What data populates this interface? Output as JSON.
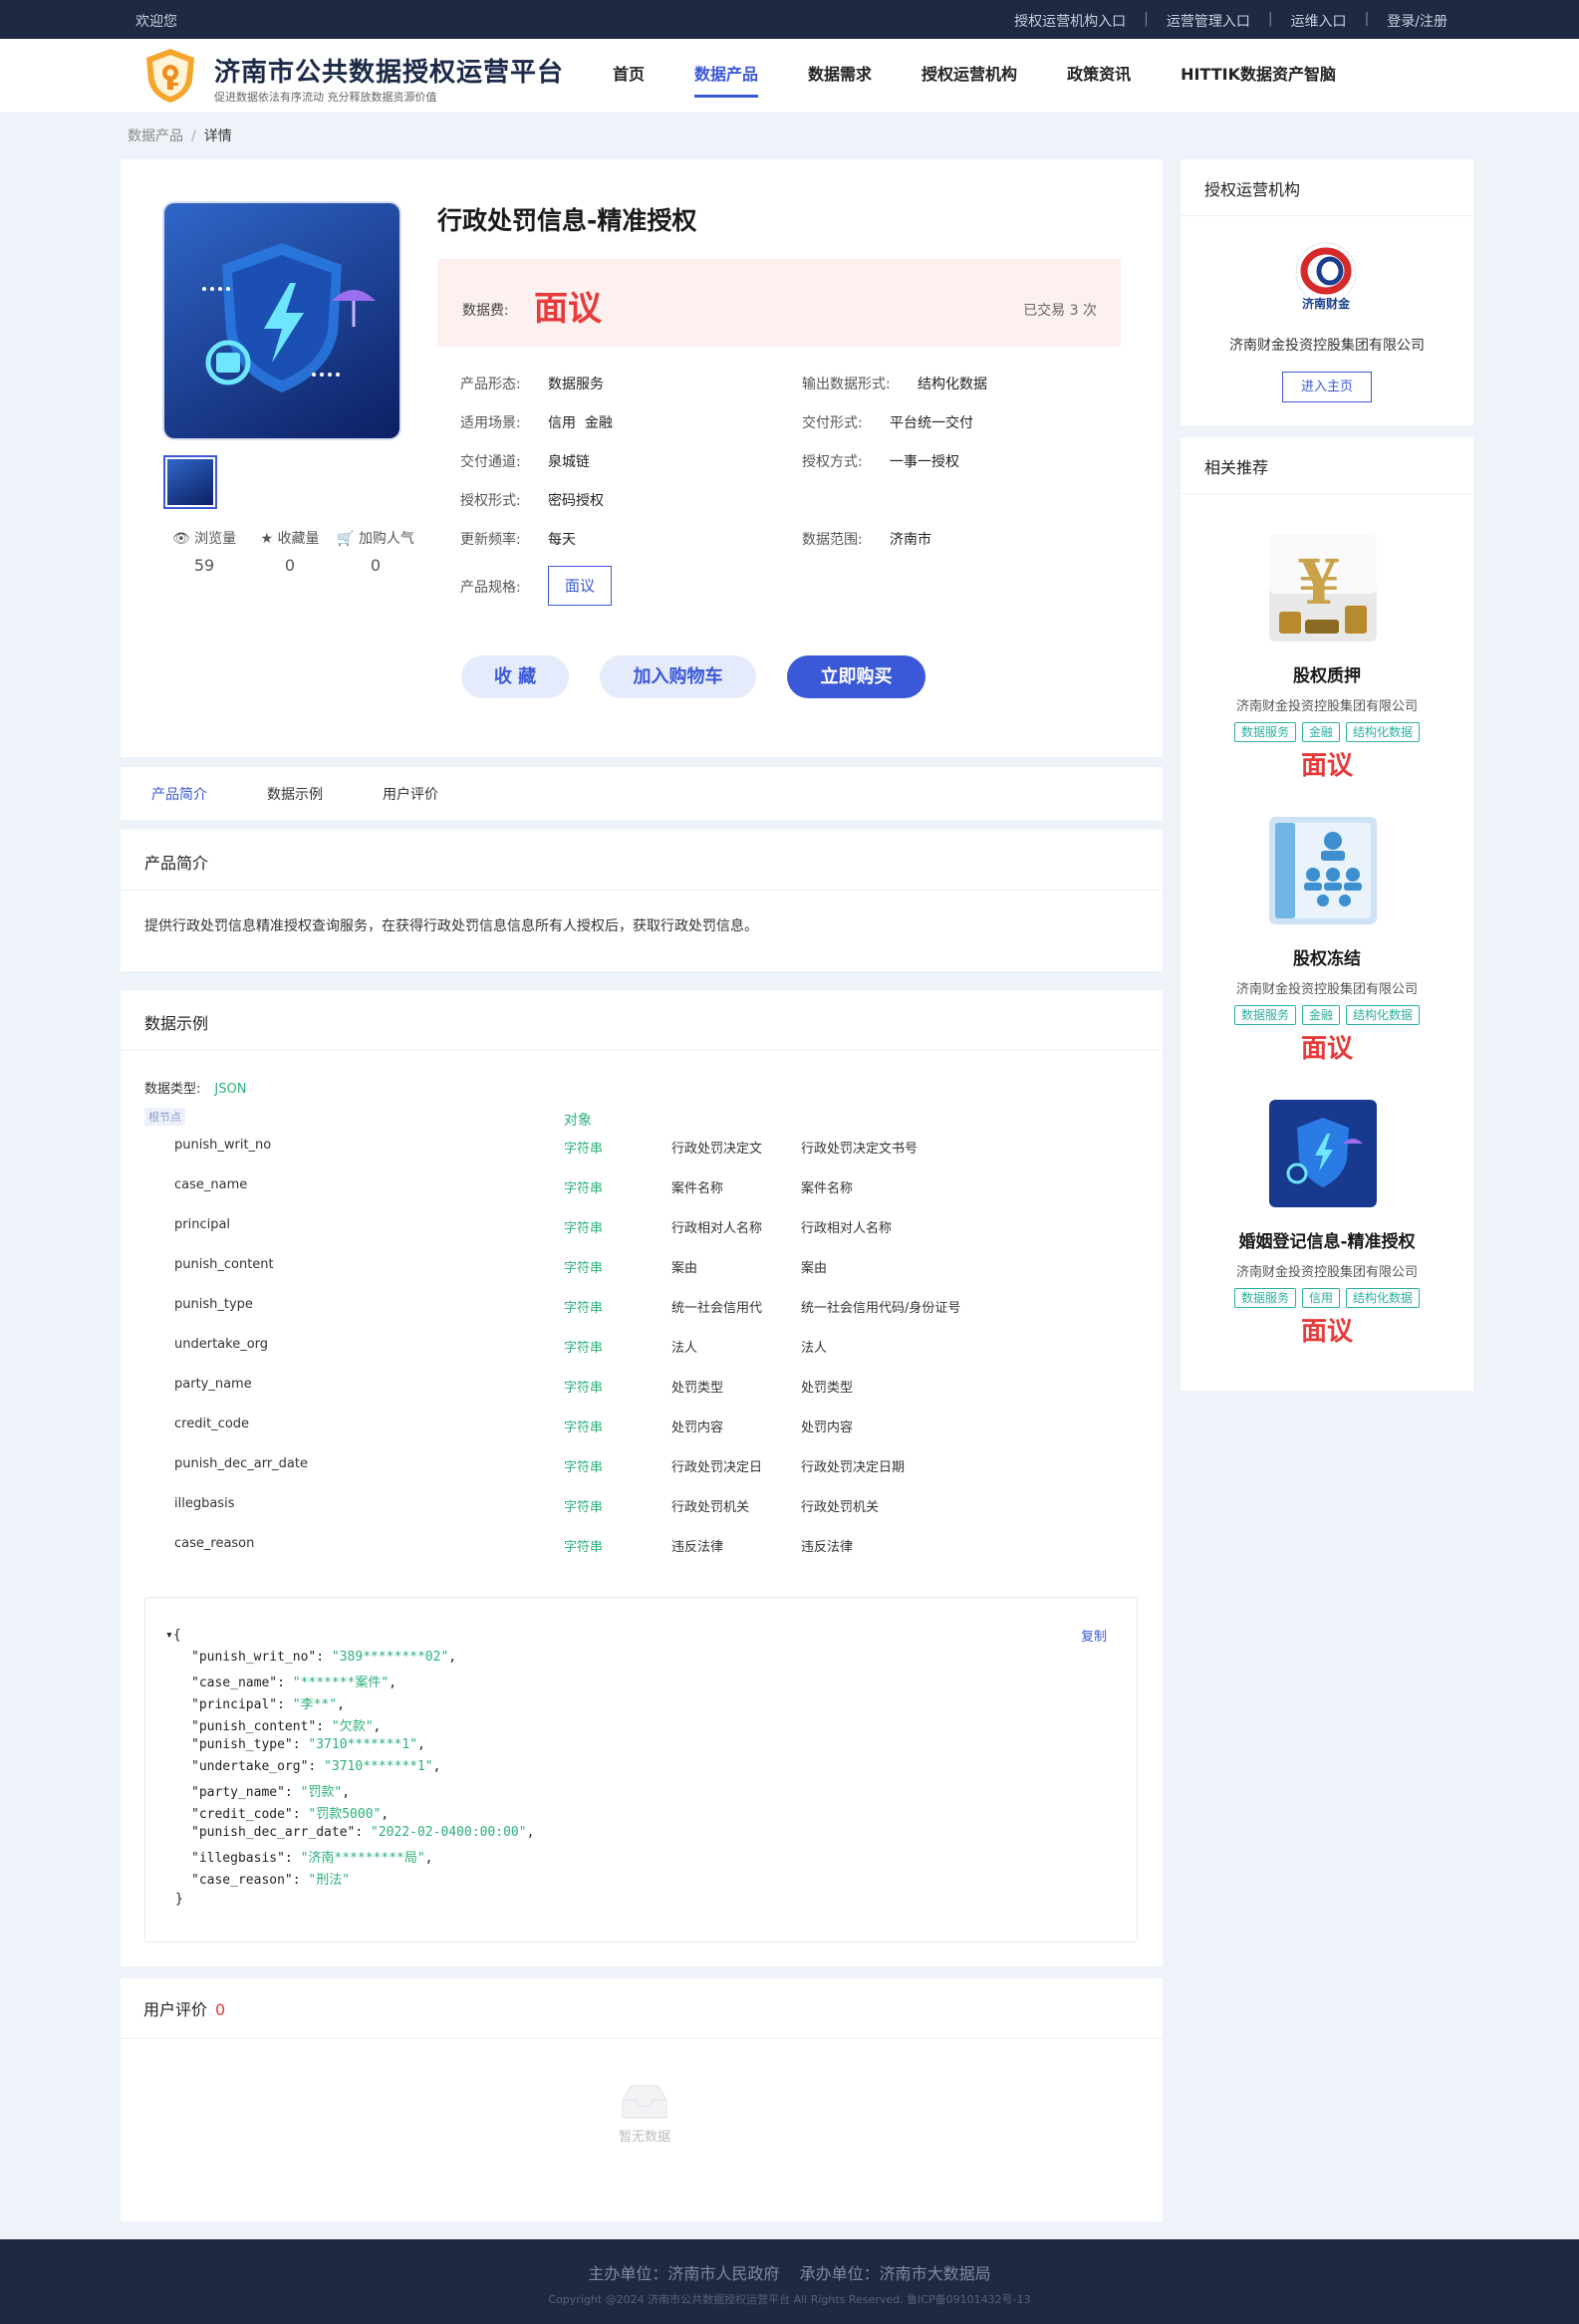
{
  "topbar": {
    "welcome": "欢迎您",
    "links": [
      "授权运营机构入口",
      "运营管理入口",
      "运维入口",
      "登录/注册"
    ]
  },
  "header": {
    "title": "济南市公共数据授权运营平台",
    "subtitle": "促进数据依法有序流动 充分释放数据资源价值",
    "nav": [
      "首页",
      "数据产品",
      "数据需求",
      "授权运营机构",
      "政策资讯",
      "HITTIK数据资产智脑"
    ],
    "active_nav": "数据产品"
  },
  "breadcrumb": {
    "parent": "数据产品",
    "separator": "/",
    "current": "详情"
  },
  "product": {
    "title": "行政处罚信息-精准授权",
    "price_label": "数据费:",
    "price": "面议",
    "trade_count": "已交易 3 次",
    "stats": [
      {
        "icon": "eye-icon",
        "label": "浏览量",
        "value": "59"
      },
      {
        "icon": "star-icon",
        "label": "收藏量",
        "value": "0"
      },
      {
        "icon": "cart-icon",
        "label": "加购人气",
        "value": "0"
      }
    ],
    "specs_left": [
      {
        "k": "产品形态:",
        "v": "数据服务"
      },
      {
        "k": "适用场景:",
        "v": "信用  金融"
      },
      {
        "k": "交付通道:",
        "v": "泉城链"
      },
      {
        "k": "授权形式:",
        "v": "密码授权"
      },
      {
        "k": "更新频率:",
        "v": "每天"
      }
    ],
    "specs_right": [
      {
        "k": "输出数据形式:",
        "v": "结构化数据"
      },
      {
        "k": "交付形式:",
        "v": "平台统一交付"
      },
      {
        "k": "授权方式:",
        "v": "一事一授权"
      },
      {
        "k": "数据范围:",
        "v": "济南市"
      }
    ],
    "spec_label": "产品规格:",
    "spec_option": "面议",
    "buttons": {
      "favorite": "收 藏",
      "cart": "加入购物车",
      "buy": "立即购买"
    }
  },
  "tabs": [
    "产品简介",
    "数据示例",
    "用户评价"
  ],
  "intro": {
    "title": "产品简介",
    "text": "提供行政处罚信息精准授权查询服务，在获得行政处罚信息信息所有人授权后，获取行政处罚信息。"
  },
  "example": {
    "title": "数据示例",
    "type_label": "数据类型:",
    "type_value": "JSON",
    "root_label": "根节点",
    "root_type": "对象",
    "fields": [
      {
        "name": "punish_writ_no",
        "type": "字符串",
        "c1": "行政处罚决定文",
        "c2": "行政处罚决定文书号"
      },
      {
        "name": "case_name",
        "type": "字符串",
        "c1": "案件名称",
        "c2": "案件名称"
      },
      {
        "name": "principal",
        "type": "字符串",
        "c1": "行政相对人名称",
        "c2": "行政相对人名称"
      },
      {
        "name": "punish_content",
        "type": "字符串",
        "c1": "案由",
        "c2": "案由"
      },
      {
        "name": "punish_type",
        "type": "字符串",
        "c1": "统一社会信用代",
        "c2": "统一社会信用代码/身份证号"
      },
      {
        "name": "undertake_org",
        "type": "字符串",
        "c1": "法人",
        "c2": "法人"
      },
      {
        "name": "party_name",
        "type": "字符串",
        "c1": "处罚类型",
        "c2": "处罚类型"
      },
      {
        "name": "credit_code",
        "type": "字符串",
        "c1": "处罚内容",
        "c2": "处罚内容"
      },
      {
        "name": "punish_dec_arr_date",
        "type": "字符串",
        "c1": "行政处罚决定日",
        "c2": "行政处罚决定日期"
      },
      {
        "name": "illegbasis",
        "type": "字符串",
        "c1": "行政处罚机关",
        "c2": "行政处罚机关"
      },
      {
        "name": "case_reason",
        "type": "字符串",
        "c1": "违反法律",
        "c2": "违反法律"
      }
    ],
    "copy_label": "复制",
    "json_open": "{",
    "json_close": "}",
    "json_lines": [
      {
        "key": "\"punish_writ_no\": ",
        "val": "\"389********02\"",
        "end": ","
      },
      {
        "key": "\"case_name\": ",
        "val": "\"*******案件\"",
        "end": ","
      },
      {
        "key": "\"principal\": ",
        "val": "\"李**\"",
        "end": ","
      },
      {
        "key": "\"punish_content\": ",
        "val": "\"欠款\"",
        "end": ","
      },
      {
        "key": "\"punish_type\": ",
        "val": "\"3710*******1\"",
        "end": ","
      },
      {
        "key": "\"undertake_org\": ",
        "val": "\"3710*******1\"",
        "end": ","
      },
      {
        "key": "\"party_name\": ",
        "val": "\"罚款\"",
        "end": ","
      },
      {
        "key": "\"credit_code\": ",
        "val": "\"罚款5000\"",
        "end": ","
      },
      {
        "key": "\"punish_dec_arr_date\": ",
        "val": "\"2022-02-0400:00:00\"",
        "end": ","
      },
      {
        "key": "\"illegbasis\": ",
        "val": "\"济南*********局\"",
        "end": ","
      },
      {
        "key": "\"case_reason\": ",
        "val": "\"刑法\"",
        "end": ""
      }
    ]
  },
  "review": {
    "title": "用户评价",
    "count": "0",
    "empty": "暂无数据"
  },
  "sidebar": {
    "org_title": "授权运营机构",
    "org_logo_text": "济南财金",
    "org_name": "济南财金投资控股集团有限公司",
    "enter_button": "进入主页",
    "rec_title": "相关推荐",
    "recommendations": [
      {
        "name": "股权质押",
        "company": "济南财金投资控股集团有限公司",
        "tags": [
          "数据服务",
          "金融",
          "结构化数据"
        ],
        "price": "面议"
      },
      {
        "name": "股权冻结",
        "company": "济南财金投资控股集团有限公司",
        "tags": [
          "数据服务",
          "金融",
          "结构化数据"
        ],
        "price": "面议"
      },
      {
        "name": "婚姻登记信息-精准授权",
        "company": "济南财金投资控股集团有限公司",
        "tags": [
          "数据服务",
          "信用",
          "结构化数据"
        ],
        "price": "面议"
      }
    ]
  },
  "footer": {
    "line1": "主办单位：济南市人民政府    承办单位：济南市大数据局",
    "line2": "Copyright @2024 济南市公共数据授权运营平台 All Rights Reserved. 鲁ICP备09101432号-13"
  },
  "colors": {
    "accent": "#3a58d8",
    "price": "#e83a3a",
    "tag": "#2ab0a0",
    "topbar": "#1e2a44"
  }
}
